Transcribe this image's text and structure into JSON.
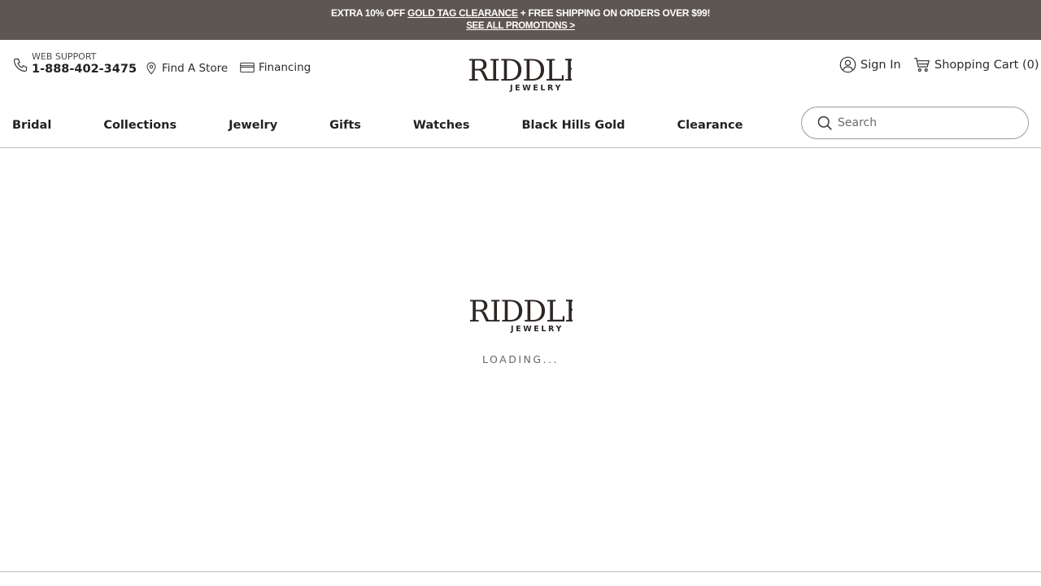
{
  "promo": {
    "line1_prefix": "EXTRA 10% OFF ",
    "line1_link": "GOLD TAG CLEARANCE",
    "line1_suffix": " + FREE SHIPPING ON ORDERS OVER $99!",
    "line2": "SEE ALL PROMOTIONS >"
  },
  "support": {
    "label": "WEB SUPPORT",
    "phone": "1-888-402-3475"
  },
  "utility": {
    "find_store": "Find A Store",
    "financing": "Financing"
  },
  "logo": {
    "name": "RIDDLE'S",
    "sub": "JEWELRY"
  },
  "account": {
    "sign_in": "Sign In",
    "cart": "Shopping Cart (0)"
  },
  "nav": {
    "items": [
      {
        "label": "Bridal"
      },
      {
        "label": "Collections"
      },
      {
        "label": "Jewelry"
      },
      {
        "label": "Gifts"
      },
      {
        "label": "Watches"
      },
      {
        "label": "Black Hills Gold"
      },
      {
        "label": "Clearance"
      }
    ]
  },
  "search": {
    "placeholder": "Search"
  },
  "loading": {
    "text": "LOADING..."
  },
  "colors": {
    "promo_bg": "#5e5650",
    "logo": "#2d2623"
  }
}
